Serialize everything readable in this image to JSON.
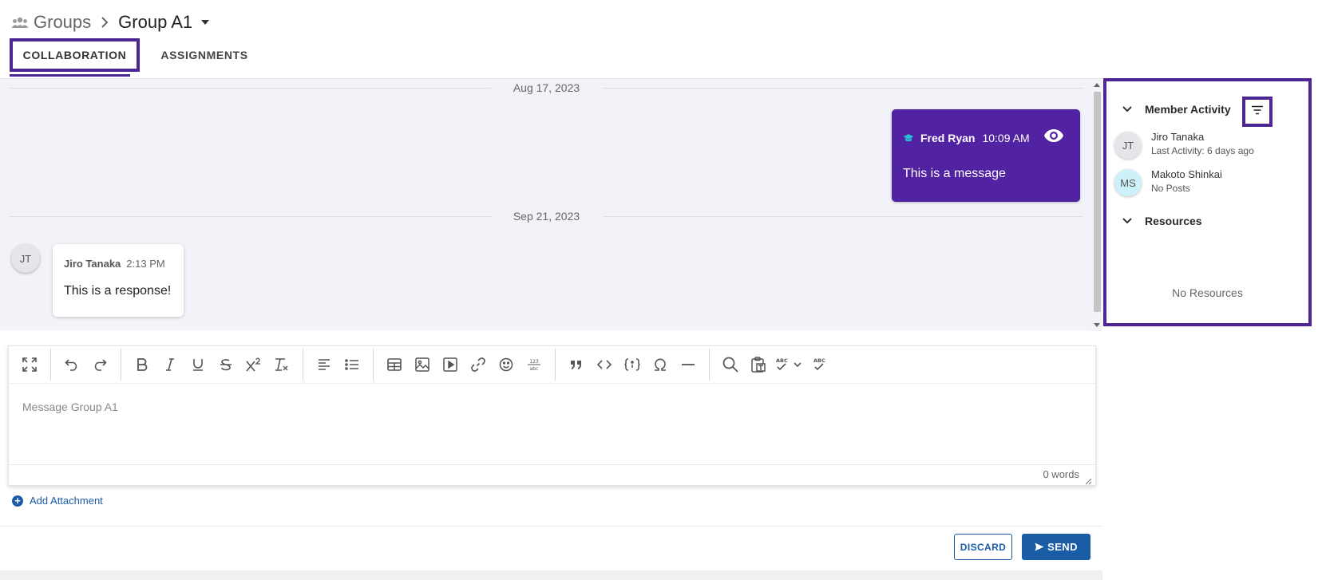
{
  "header": {
    "root_label": "Groups",
    "current_label": "Group A1"
  },
  "tabs": [
    {
      "label": "COLLABORATION",
      "active": true
    },
    {
      "label": "ASSIGNMENTS",
      "active": false
    }
  ],
  "chat": {
    "date_1": "Aug 17, 2023",
    "date_2": "Sep 21, 2023",
    "messages": [
      {
        "author": "Fred Ryan",
        "time": "10:09 AM",
        "text": "This is a message",
        "own": true
      },
      {
        "author": "Jiro Tanaka",
        "initials": "JT",
        "time": "2:13 PM",
        "text": "This is a response!",
        "own": false
      }
    ]
  },
  "editor": {
    "placeholder": "Message Group A1",
    "word_count": "0 words"
  },
  "actions": {
    "add_attachment": "Add Attachment",
    "discard": "DISCARD",
    "send": "SEND"
  },
  "side_panel": {
    "member_activity_title": "Member Activity",
    "members": [
      {
        "initials": "JT",
        "name": "Jiro Tanaka",
        "status": "Last Activity: 6 days ago",
        "color": "#e4e6ea"
      },
      {
        "initials": "MS",
        "name": "Makoto Shinkai",
        "status": "No Posts",
        "color": "#cdf1f8"
      }
    ],
    "resources_title": "Resources",
    "no_resources": "No Resources"
  },
  "colors": {
    "accent_purple": "#4b2694",
    "message_bubble": "#5122a1",
    "primary_blue": "#1a5da6",
    "chat_bg": "#f2f3f8"
  }
}
